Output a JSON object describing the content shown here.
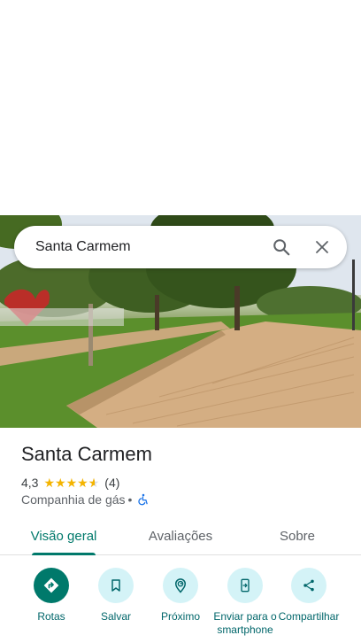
{
  "search": {
    "query": "Santa Carmem"
  },
  "place": {
    "name": "Santa Carmem",
    "rating": "4,3",
    "stars": 4.3,
    "reviews": "(4)",
    "category": "Companhia de gás",
    "separator": "•"
  },
  "tabs": [
    {
      "label": "Visão geral",
      "active": true
    },
    {
      "label": "Avaliações",
      "active": false
    },
    {
      "label": "Sobre",
      "active": false
    }
  ],
  "actions": [
    {
      "label": "Rotas"
    },
    {
      "label": "Salvar"
    },
    {
      "label": "Próximo"
    },
    {
      "label": "Enviar para o\nsmartphone"
    },
    {
      "label": "Compartilhar"
    }
  ],
  "colors": {
    "accent": "#00796b",
    "action_bg": "#d4f3f7",
    "star": "#f4b400"
  },
  "icons": {
    "search": "search-icon",
    "close": "close-icon",
    "directions": "directions-icon",
    "save": "bookmark-icon",
    "nearby": "nearby-icon",
    "send": "send-to-phone-icon",
    "share": "share-icon",
    "wheelchair": "wheelchair-icon"
  }
}
